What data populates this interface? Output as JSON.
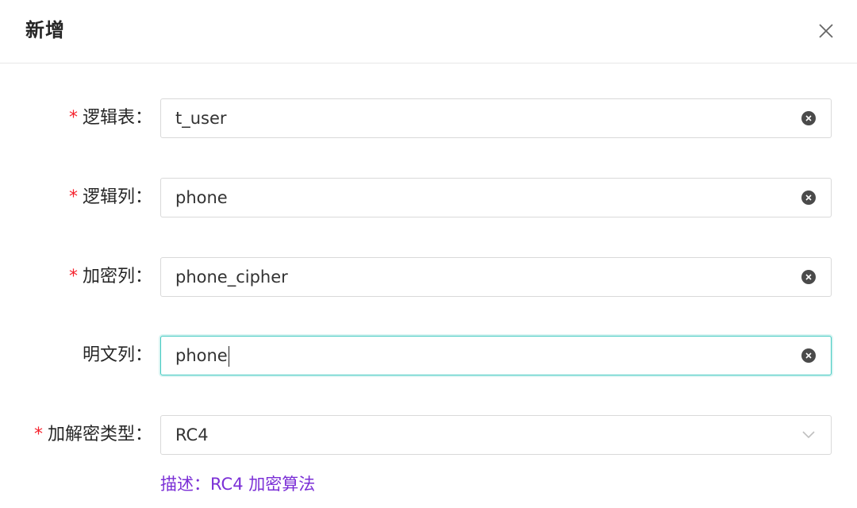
{
  "dialog": {
    "title": "新增"
  },
  "form": {
    "required_mark": "*",
    "colon": "：",
    "fields": [
      {
        "label": "逻辑表",
        "required": true,
        "value": "t_user"
      },
      {
        "label": "逻辑列",
        "required": true,
        "value": "phone"
      },
      {
        "label": "加密列",
        "required": true,
        "value": "phone_cipher"
      },
      {
        "label": "明文列",
        "required": false,
        "value": "phone"
      }
    ],
    "encrypt_type": {
      "label": "加解密类型",
      "required": true,
      "selected": "RC4"
    },
    "description": "描述：RC4 加密算法"
  },
  "colors": {
    "required": "#f5222d",
    "focus_border": "#40c9c0",
    "description": "#7b2fd6"
  },
  "icons": {
    "close": "close-icon",
    "clear": "clear-circle-icon",
    "select_arrow": "chevron-down-icon"
  }
}
